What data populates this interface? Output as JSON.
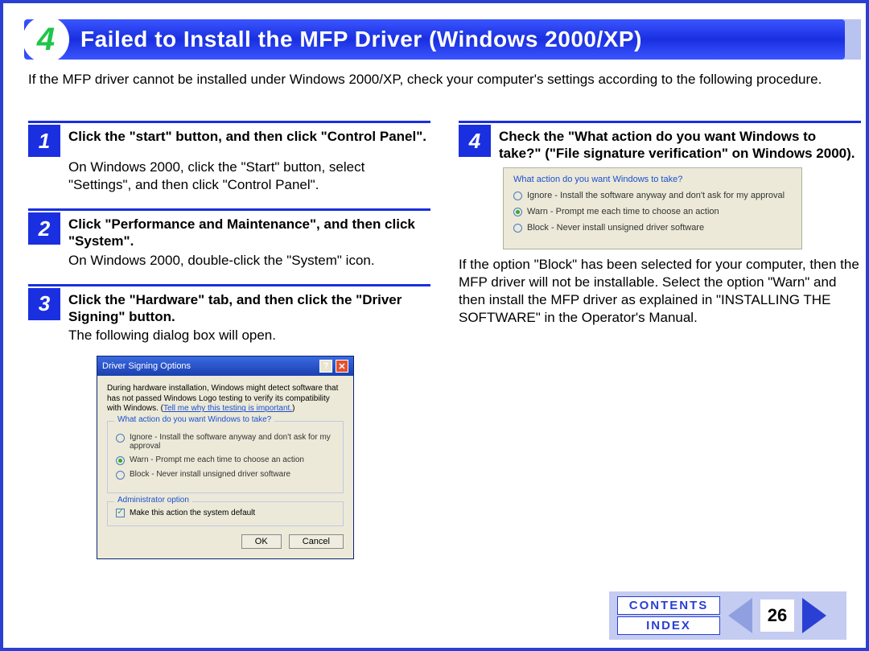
{
  "section_number": "4",
  "title": "Failed to Install the MFP Driver (Windows 2000/XP)",
  "intro": "If the MFP driver cannot be installed under Windows 2000/XP, check your computer's settings according to the following procedure.",
  "steps_left": [
    {
      "n": "1",
      "title": "Click the \"start\" button, and then click \"Control Panel\".",
      "body": "On Windows 2000, click the \"Start\" button, select \"Settings\", and then click \"Control Panel\"."
    },
    {
      "n": "2",
      "title": "Click \"Performance and Maintenance\", and then click \"System\".",
      "body": "On Windows 2000, double-click the \"System\" icon."
    },
    {
      "n": "3",
      "title": "Click the \"Hardware\" tab, and then click the \"Driver Signing\" button.",
      "body": "The following dialog box will open."
    }
  ],
  "dialog": {
    "title": "Driver Signing Options",
    "intro_a": "During hardware installation, Windows might detect software that has not passed Windows Logo testing to verify its compatibility with Windows. (",
    "intro_link": "Tell me why this testing is important.",
    "intro_b": ")",
    "group1_legend": "What action do you want Windows to take?",
    "opt_ignore": "Ignore - Install the software anyway and don't ask for my approval",
    "opt_warn": "Warn - Prompt me each time to choose an action",
    "opt_block": "Block - Never install unsigned driver software",
    "group2_legend": "Administrator option",
    "check_label": "Make this action the system default",
    "ok": "OK",
    "cancel": "Cancel"
  },
  "step_right": {
    "n": "4",
    "title": "Check the \"What action do you want Windows to take?\" (\"File signature verification\" on Windows 2000).",
    "after": "If the option \"Block\" has been selected for your computer, then the MFP driver will not be installable. Select the option \"Warn\" and then install the MFP driver as explained in \"INSTALLING THE SOFTWARE\" in the Operator's Manual."
  },
  "footer": {
    "contents": "CONTENTS",
    "index": "INDEX",
    "page": "26"
  }
}
